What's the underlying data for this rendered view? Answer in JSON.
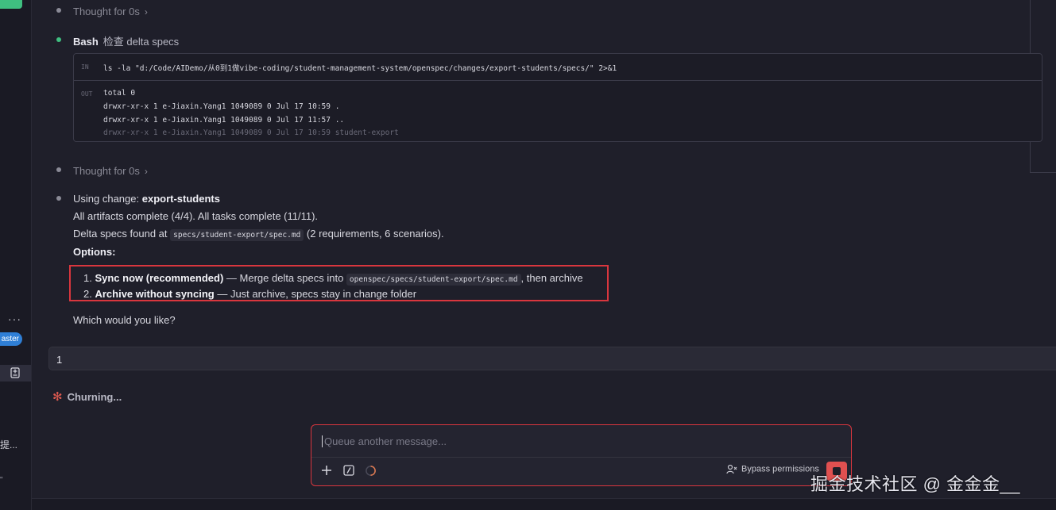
{
  "thought1": {
    "label": "Thought for 0s",
    "chevron": "›"
  },
  "bash": {
    "tool": "Bash",
    "description": "检查 delta specs",
    "in_tag": "IN",
    "out_tag": "OUT",
    "command": "ls -la \"d:/Code/AIDemo/从0到1做vibe-coding/student-management-system/openspec/changes/export-students/specs/\" 2>&1",
    "output": [
      "total 0",
      "drwxr-xr-x 1 e-Jiaxin.Yang1 1049089 0 Jul 17 10:59 .",
      "drwxr-xr-x 1 e-Jiaxin.Yang1 1049089 0 Jul 17 11:57 ..",
      "drwxr-xr-x 1 e-Jiaxin.Yang1 1049089 0 Jul 17 10:59 student-export"
    ]
  },
  "thought2": {
    "label": "Thought for 0s",
    "chevron": "›"
  },
  "response": {
    "using_prefix": "Using change: ",
    "change_name": "export-students",
    "artifacts_line": "All artifacts complete (4/4). All tasks complete (11/11).",
    "delta_prefix": "Delta specs found at ",
    "delta_path": "specs/student-export/spec.md",
    "delta_suffix": " (2 requirements, 6 scenarios).",
    "options_heading": "Options:",
    "option1_num": "1. ",
    "option1_title": "Sync now (recommended)",
    "option1_mid": " — Merge delta specs into ",
    "option1_path": "openspec/specs/student-export/spec.md",
    "option1_end": ", then archive",
    "option2_num": "2. ",
    "option2_title": "Archive without syncing",
    "option2_end": " — Just archive, specs stay in change folder",
    "question": "Which would you like?"
  },
  "user_message": "1",
  "status": {
    "icon": "✻",
    "label": "Churning..."
  },
  "composer": {
    "placeholder": "Queue another message...",
    "bypass_label": "Bypass permissions"
  },
  "sidebar": {
    "dots": "···",
    "branch_badge": "aster",
    "truncated_text": "提...",
    "truncated_text2": "\""
  },
  "watermark": "掘金技术社区 @ 金金金__",
  "colors": {
    "accent_red": "#d9363e",
    "success_green": "#3fbf80",
    "badge_blue": "#2f7fd6"
  }
}
